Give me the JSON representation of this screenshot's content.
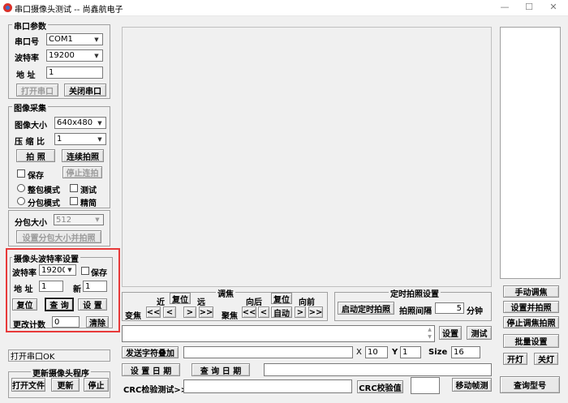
{
  "window": {
    "title": "串口摄像头测试 -- 尚鑫航电子",
    "min": "—",
    "max": "☐",
    "close": "✕"
  },
  "serial": {
    "title": "串口参数",
    "port_label": "串口号",
    "port_value": "COM1",
    "baud_label": "波特率",
    "baud_value": "19200",
    "addr_label": "地  址",
    "addr_value": "1",
    "open_btn": "打开串口",
    "close_btn": "关闭串口"
  },
  "capture": {
    "title": "图像采集",
    "size_label": "图像大小",
    "size_value": "640x480",
    "ratio_label": "压 缩 比",
    "ratio_value": "1",
    "shoot_btn": "拍  照",
    "continuous_btn": "连续拍照",
    "save_label": "保存",
    "stop_btn": "停止连拍",
    "whole_label": "整包模式",
    "test_label": "测试",
    "split_label": "分包模式",
    "compact_label": "精简"
  },
  "packet": {
    "size_label": "分包大小",
    "size_value": "512",
    "set_btn": "设置分包大小并拍照"
  },
  "camera_baud": {
    "title": "摄像头波特率设置",
    "baud_label": "波特率",
    "baud_value": "19200",
    "save_label": "保存",
    "addr_label": "地  址",
    "addr_value": "1",
    "new_label": "新",
    "new_value": "1",
    "reset_btn": "复位",
    "query_btn": "查  询",
    "set_btn": "设  置",
    "count_label": "更改计数",
    "count_value": "0",
    "clear_btn": "清除"
  },
  "status": {
    "text": "打开串口OK"
  },
  "update": {
    "title": "更新摄像头程序",
    "open_btn": "打开文件",
    "update_btn": "更新",
    "stop_btn": "停止"
  },
  "focus": {
    "title": "调焦",
    "near_label": "近",
    "reset1_btn": "复位",
    "far_label": "远",
    "back_label": "向后",
    "reset2_btn": "复位",
    "fwd_label": "向前",
    "zoom_label": "变焦",
    "focus_label": "聚焦",
    "fast_left": "<<",
    "left": "<",
    "right": ">",
    "fast_right": ">>",
    "auto_btn": "自动"
  },
  "timer": {
    "title": "定时拍照设置",
    "start_btn": "启动定时拍照",
    "interval_label": "拍照间隔",
    "interval_value": "5",
    "unit_label": "分钟"
  },
  "send": {
    "set_btn": "设置",
    "test_btn": "测试",
    "add_btn": "发送字符叠加",
    "x_label": "X",
    "x_value": "10",
    "y_label": "Y",
    "y_value": "1",
    "size_label": "Size",
    "size_value": "16",
    "setdate_btn": "设 置 日 期",
    "querydate_btn": "查 询 日 期",
    "crc_label": "CRC检验测试>>",
    "crc_btn": "CRC校验值",
    "move_btn": "移动帧测"
  },
  "right": {
    "manual_btn": "手动调焦",
    "setshoot_btn": "设置并拍照",
    "stopfocus_btn": "停止调焦拍照",
    "batch_btn": "批量设置",
    "light_on_btn": "开灯",
    "light_off_btn": "关灯",
    "model_btn": "查询型号"
  }
}
